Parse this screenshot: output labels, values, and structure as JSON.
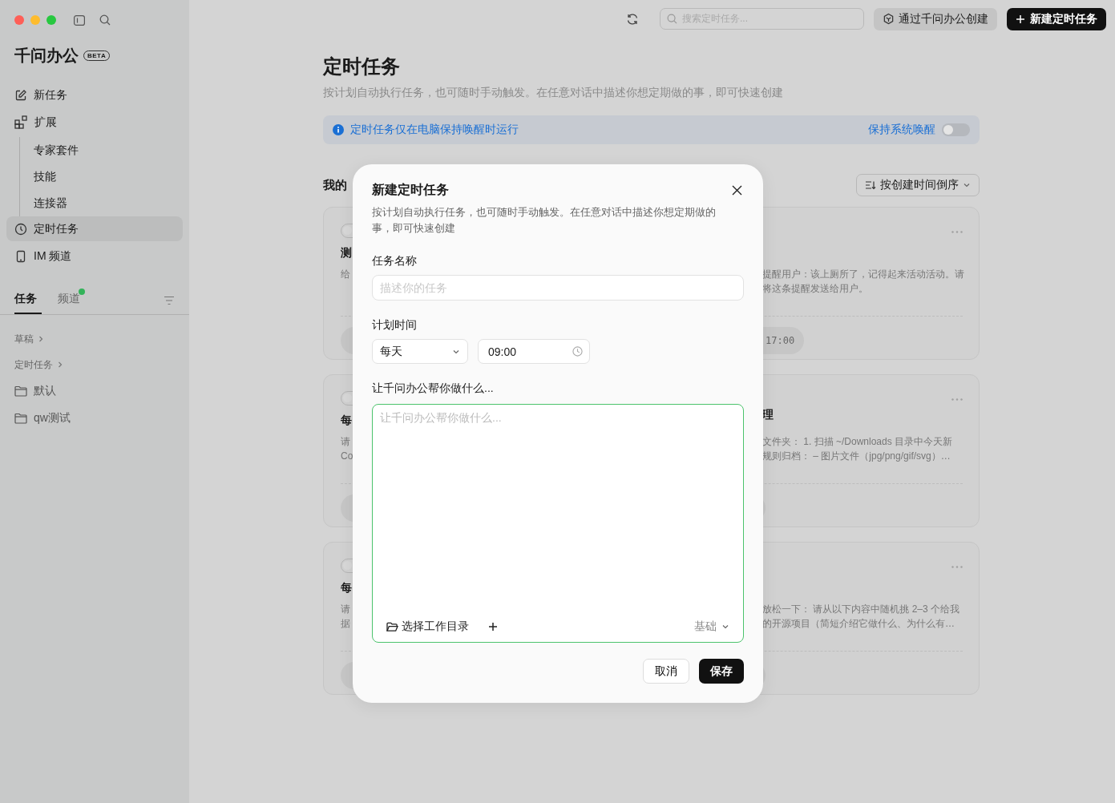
{
  "sidebar": {
    "logo": "千问办公",
    "badge": "BETA",
    "nav": [
      {
        "label": "新任务",
        "selected": false
      },
      {
        "label": "扩展",
        "selected": false,
        "children": [
          {
            "label": "专家套件"
          },
          {
            "label": "技能"
          },
          {
            "label": "连接器"
          }
        ]
      },
      {
        "label": "定时任务",
        "selected": true
      },
      {
        "label": "IM 频道",
        "selected": false
      }
    ],
    "tabs": [
      {
        "label": "任务",
        "selected": true,
        "dot": false
      },
      {
        "label": "频道",
        "selected": false,
        "dot": true
      }
    ],
    "list": [
      {
        "kind": "group",
        "label": "草稿"
      },
      {
        "kind": "group",
        "label": "定时任务"
      },
      {
        "kind": "folder",
        "label": "默认"
      },
      {
        "kind": "folder",
        "label": "qw测试"
      }
    ]
  },
  "topbar": {
    "search": {
      "placeholder": "搜索定时任务..."
    },
    "create_via": "通过千问办公创建",
    "new_button": "新建定时任务"
  },
  "page": {
    "title": "定时任务",
    "subtitle": "按计划自动执行任务，也可随时手动触发。在任意对话中描述你想定期做的事，即可快速创建",
    "banner": {
      "text": "定时任务仅在电脑保持唤醒时运行",
      "toggle_label": "保持系统唤醒",
      "on": false
    },
    "section_title": "我的",
    "sort": "按创建时间倒序",
    "cards": [
      {
        "on": false,
        "title_left": "测",
        "desc_left": [
          "给"
        ],
        "desc_right": [
          "提醒用户：该上厕所了，记得起来活动活动。请",
          "将这条提醒发送给用户。"
        ],
        "time_right": "17:00"
      },
      {
        "on": false,
        "title_left": "每",
        "title_right": "理",
        "desc_left": [
          "请",
          "Co"
        ],
        "desc_right": [
          "文件夹：  1. 扫描 ~/Downloads 目录中今天新",
          "规则归档：  – 图片文件（jpg/png/gif/svg）…"
        ]
      },
      {
        "on": false,
        "title_left": "每",
        "desc_left": [
          "请",
          "据"
        ],
        "desc_right": [
          "放松一下：  请从以下内容中随机挑 2–3 个给我",
          "的开源项目（简短介绍它做什么、为什么有…"
        ]
      }
    ]
  },
  "dialog": {
    "title": "新建定时任务",
    "description": "按计划自动执行任务，也可随时手动触发。在任意对话中描述你想定期做的事，即可快速创建",
    "name_label": "任务名称",
    "name_placeholder": "描述你的任务",
    "schedule_label": "计划时间",
    "frequency": "每天",
    "time": "09:00",
    "prompt_label": "让千问办公帮你做什么...",
    "prompt_placeholder": "让千问办公帮你做什么...",
    "folder_button": "选择工作目录",
    "mode": "基础",
    "cancel": "取消",
    "save": "保存"
  }
}
